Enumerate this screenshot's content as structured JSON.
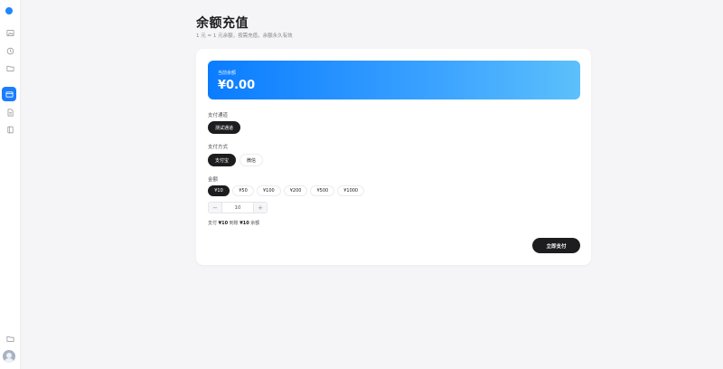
{
  "sidebar": {
    "icons": [
      "image-icon",
      "clock-icon",
      "folder-icon",
      "card-icon",
      "document-icon",
      "book-icon"
    ],
    "active": "card-icon",
    "bottom_icon": "folder-icon"
  },
  "page": {
    "title": "余额充值",
    "subtitle": "1 元 = 1 元余额，按需充值，余额永久有效"
  },
  "balance": {
    "label": "当前余额",
    "value": "¥0.00"
  },
  "channel": {
    "label": "支付通道",
    "options": [
      "测试通道"
    ],
    "selected": "测试通道"
  },
  "method": {
    "label": "支付方式",
    "options": [
      "支付宝",
      "微信"
    ],
    "selected": "支付宝"
  },
  "amount": {
    "label": "金额",
    "options": [
      "¥10",
      "¥50",
      "¥100",
      "¥200",
      "¥500",
      "¥1000"
    ],
    "selected": "¥10",
    "stepper_value": "10",
    "minus": "−",
    "plus": "+"
  },
  "summary": {
    "pay_prefix": "支付",
    "pay_amount": "¥10",
    "get_prefix": "到账",
    "get_amount": "¥10",
    "suffix": "余额"
  },
  "actions": {
    "pay_now": "立即支付"
  },
  "colors": {
    "accent": "#1a7dff",
    "dark": "#1d1d1f"
  }
}
